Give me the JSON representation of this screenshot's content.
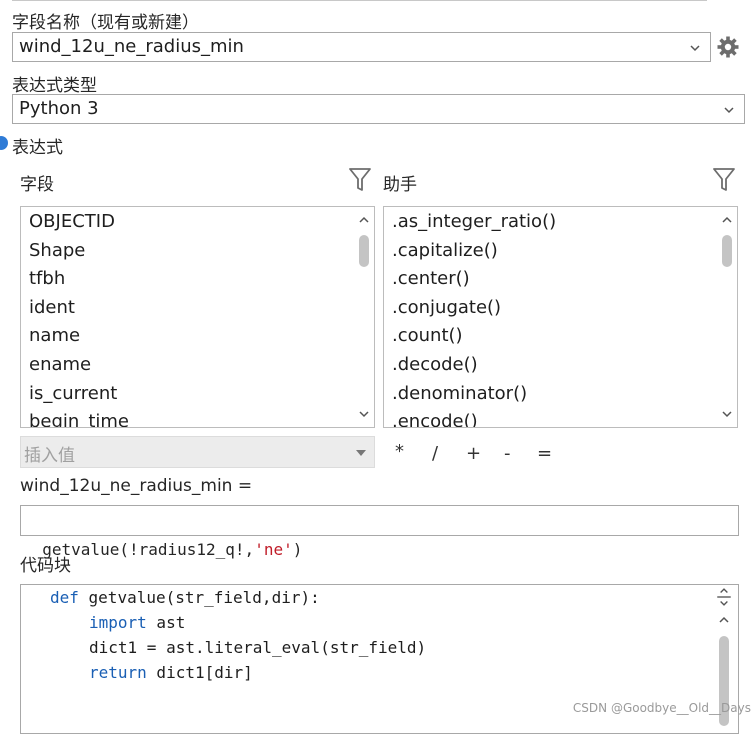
{
  "field_name": {
    "label": "字段名称（现有或新建）",
    "value": "wind_12u_ne_radius_min"
  },
  "expression_type": {
    "label": "表达式类型",
    "value": "Python 3"
  },
  "expression_section": {
    "label": "表达式"
  },
  "fields_panel": {
    "label": "字段",
    "items": [
      "OBJECTID",
      "Shape",
      "tfbh",
      "ident",
      "name",
      "ename",
      "is_current",
      "begin_time"
    ]
  },
  "helpers_panel": {
    "label": "助手",
    "items": [
      ".as_integer_ratio()",
      ".capitalize()",
      ".center()",
      ".conjugate()",
      ".count()",
      ".decode()",
      ".denominator()",
      ".encode()"
    ]
  },
  "insert_value": {
    "placeholder": "插入值"
  },
  "operators": [
    "*",
    "/",
    "+",
    "-",
    "="
  ],
  "expression": {
    "assign_label": "wind_12u_ne_radius_min =",
    "code_prefix": "getvalue(!radius12_q!,",
    "code_string": "'ne'",
    "code_suffix": ")"
  },
  "code_block": {
    "label": "代码块",
    "lines": [
      {
        "kw": "def",
        "text": " getvalue(str_field,dir):"
      },
      {
        "kw": "import",
        "text": " ast"
      },
      {
        "kw": "",
        "text": "dict1 = ast.literal_eval(str_field)"
      },
      {
        "kw": "return",
        "text": " dict1[dir]"
      }
    ]
  },
  "watermark": "CSDN @Goodbye__Old__Days",
  "colors": {
    "keyword": "#1a5fb4",
    "string": "#c01c28",
    "accent": "#2e7bd6"
  }
}
